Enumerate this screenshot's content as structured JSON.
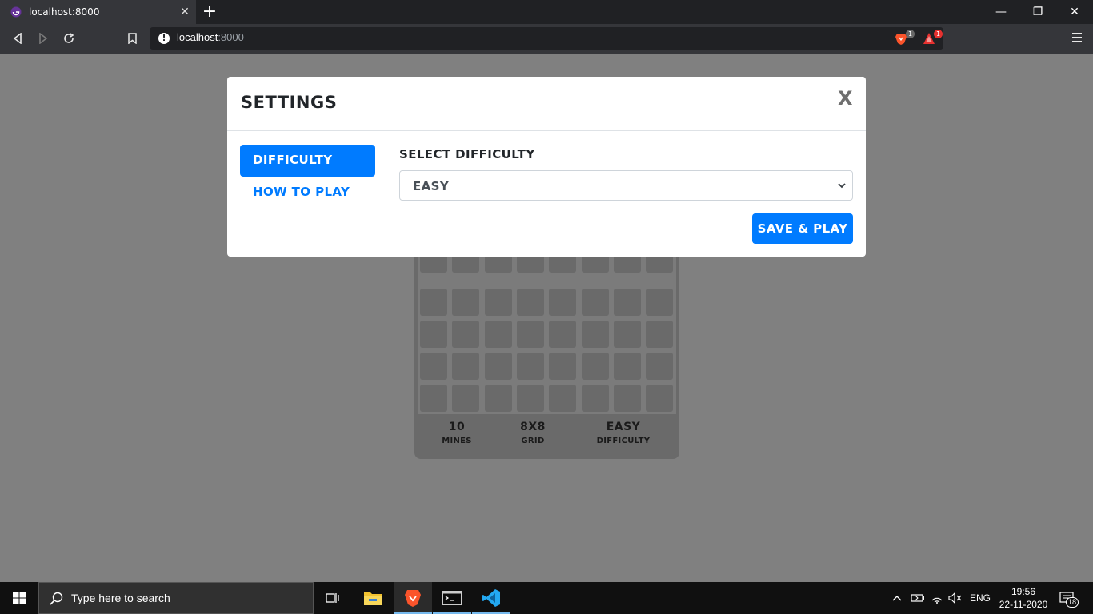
{
  "browser": {
    "tab_title": "localhost:8000",
    "tab_close": "✕",
    "new_tab": "+",
    "url_host": "localhost",
    "url_port": ":8000",
    "brave_badge": "1",
    "rewards_badge": "1",
    "window_controls": [
      "—",
      "❐",
      "✕"
    ]
  },
  "modal": {
    "title": "SETTINGS",
    "close_label": "X",
    "nav": {
      "difficulty": "DIFFICULTY",
      "how_to_play": "HOW TO PLAY"
    },
    "select_label": "SELECT DIFFICULTY",
    "select_value": "EASY",
    "save_button": "SAVE & PLAY"
  },
  "game": {
    "stats": [
      {
        "value": "10",
        "label": "MINES"
      },
      {
        "value": "8X8",
        "label": "GRID"
      },
      {
        "value": "EASY",
        "label": "DIFFICULTY"
      }
    ]
  },
  "taskbar": {
    "search_placeholder": "Type here to search",
    "language": "ENG",
    "time": "19:56",
    "date": "22-11-2020",
    "notification_count": "18"
  },
  "colors": {
    "primary": "#007bff",
    "overlay": "#808080",
    "chrome": "#35363a"
  }
}
